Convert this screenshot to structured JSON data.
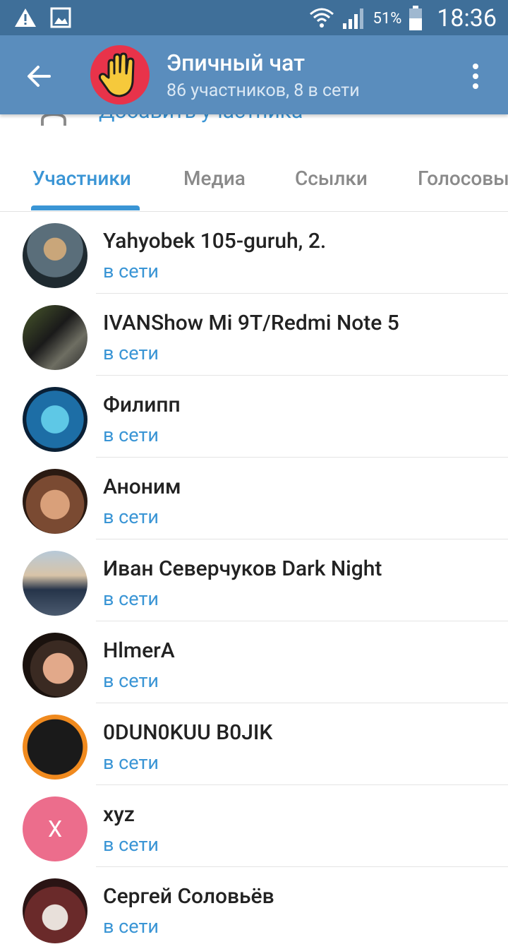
{
  "status_bar": {
    "battery_percent": "51%",
    "time": "18:36"
  },
  "header": {
    "title": "Эпичный чат",
    "subtitle": "86 участников, 8 в сети"
  },
  "partial_row": {
    "text": "Добавить участника"
  },
  "tabs": [
    {
      "label": "Участники",
      "active": true
    },
    {
      "label": "Медиа",
      "active": false
    },
    {
      "label": "Ссылки",
      "active": false
    },
    {
      "label": "Голосовые",
      "active": false
    }
  ],
  "members": [
    {
      "name": "Yahyobek 105-guruh, 2.",
      "status": "в сети"
    },
    {
      "name": "IVANShow Mi 9T/Redmi Note 5",
      "status": "в сети"
    },
    {
      "name": "Филипп",
      "status": "в сети"
    },
    {
      "name": "Аноним",
      "status": "в сети"
    },
    {
      "name": "Иван Северчуков Dark Night",
      "status": "в сети"
    },
    {
      "name": "HlmerA",
      "status": "в сети"
    },
    {
      "name": "0DUN0KUU B0JIK",
      "status": "в сети"
    },
    {
      "name": "xyz",
      "status": "в сети",
      "avatar_letter": "X"
    },
    {
      "name": "Сергей Соловьёв",
      "status": "в сети"
    }
  ],
  "colors": {
    "primary": "#5a8dbd",
    "status_bar": "#3f6f99",
    "accent": "#3a95d5"
  }
}
